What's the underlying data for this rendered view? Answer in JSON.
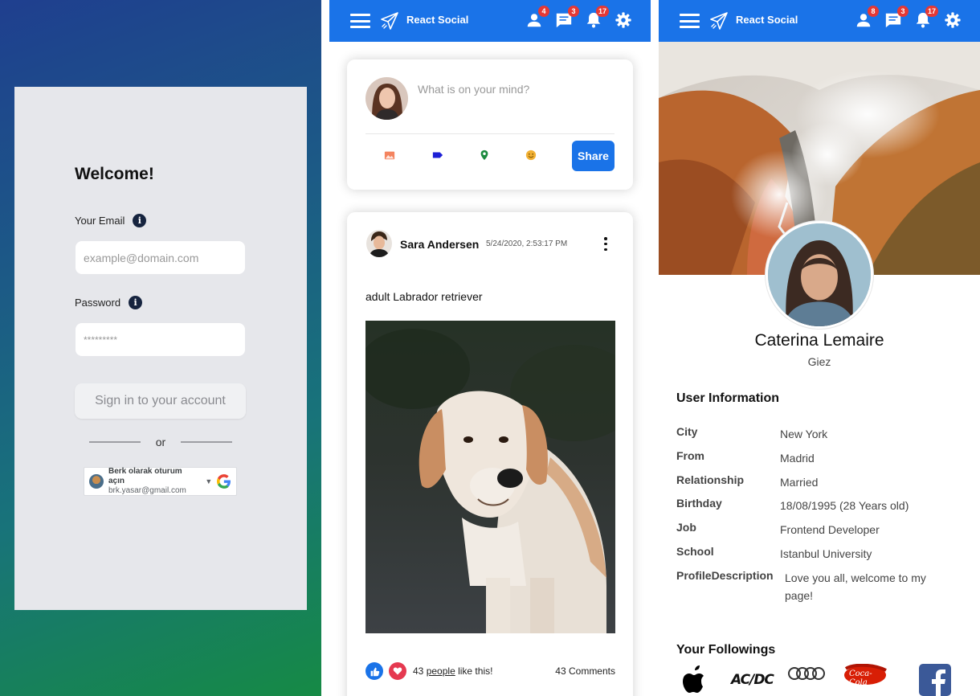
{
  "login": {
    "title": "Welcome!",
    "email_label": "Your Email",
    "email_placeholder": "example@domain.com",
    "password_label": "Password",
    "password_value": "*********",
    "signin_label": "Sign in to your account",
    "or_text": "or",
    "google": {
      "name": "Berk olarak oturum açın",
      "email": "brk.yasar@gmail.com"
    }
  },
  "topbar": {
    "brand": "React Social",
    "primary_color": "#1a73e8"
  },
  "feed": {
    "topbar_badges": {
      "friends": "4",
      "messages": "3",
      "notifications": "17"
    },
    "share": {
      "placeholder": "What is on your mind?",
      "button": "Share",
      "options": [
        "photo-icon",
        "tag-icon",
        "location-icon",
        "emoji-icon"
      ]
    },
    "post": {
      "author": "Sara Andersen",
      "date": "5/24/2020, 2:53:17 PM",
      "text": "adult Labrador retriever",
      "likes_count": "43",
      "likes_link": "people",
      "likes_suffix": "like this!",
      "comments": "43 Comments"
    }
  },
  "profile": {
    "topbar_badges": {
      "friends": "8",
      "messages": "3",
      "notifications": "17"
    },
    "name": "Caterina Lemaire",
    "subtitle": "Giez",
    "info_title": "User Information",
    "info": [
      {
        "key": "City",
        "value": "New York"
      },
      {
        "key": "From",
        "value": "Madrid"
      },
      {
        "key": "Relationship",
        "value": "Married"
      },
      {
        "key": "Birthday",
        "value": "18/08/1995 (28 Years old)"
      },
      {
        "key": "Job",
        "value": "Frontend Developer"
      },
      {
        "key": "School",
        "value": "Istanbul University"
      },
      {
        "key": "ProfileDescription",
        "value": "Love you all, welcome to my page!"
      }
    ],
    "followings_title": "Your Followings",
    "followings": [
      "apple-logo",
      "acdc-logo",
      "audi-logo",
      "coca-cola-logo",
      "facebook-logo"
    ],
    "acdc_text": "AC/DC",
    "coke_text": "Coca-Cola"
  }
}
